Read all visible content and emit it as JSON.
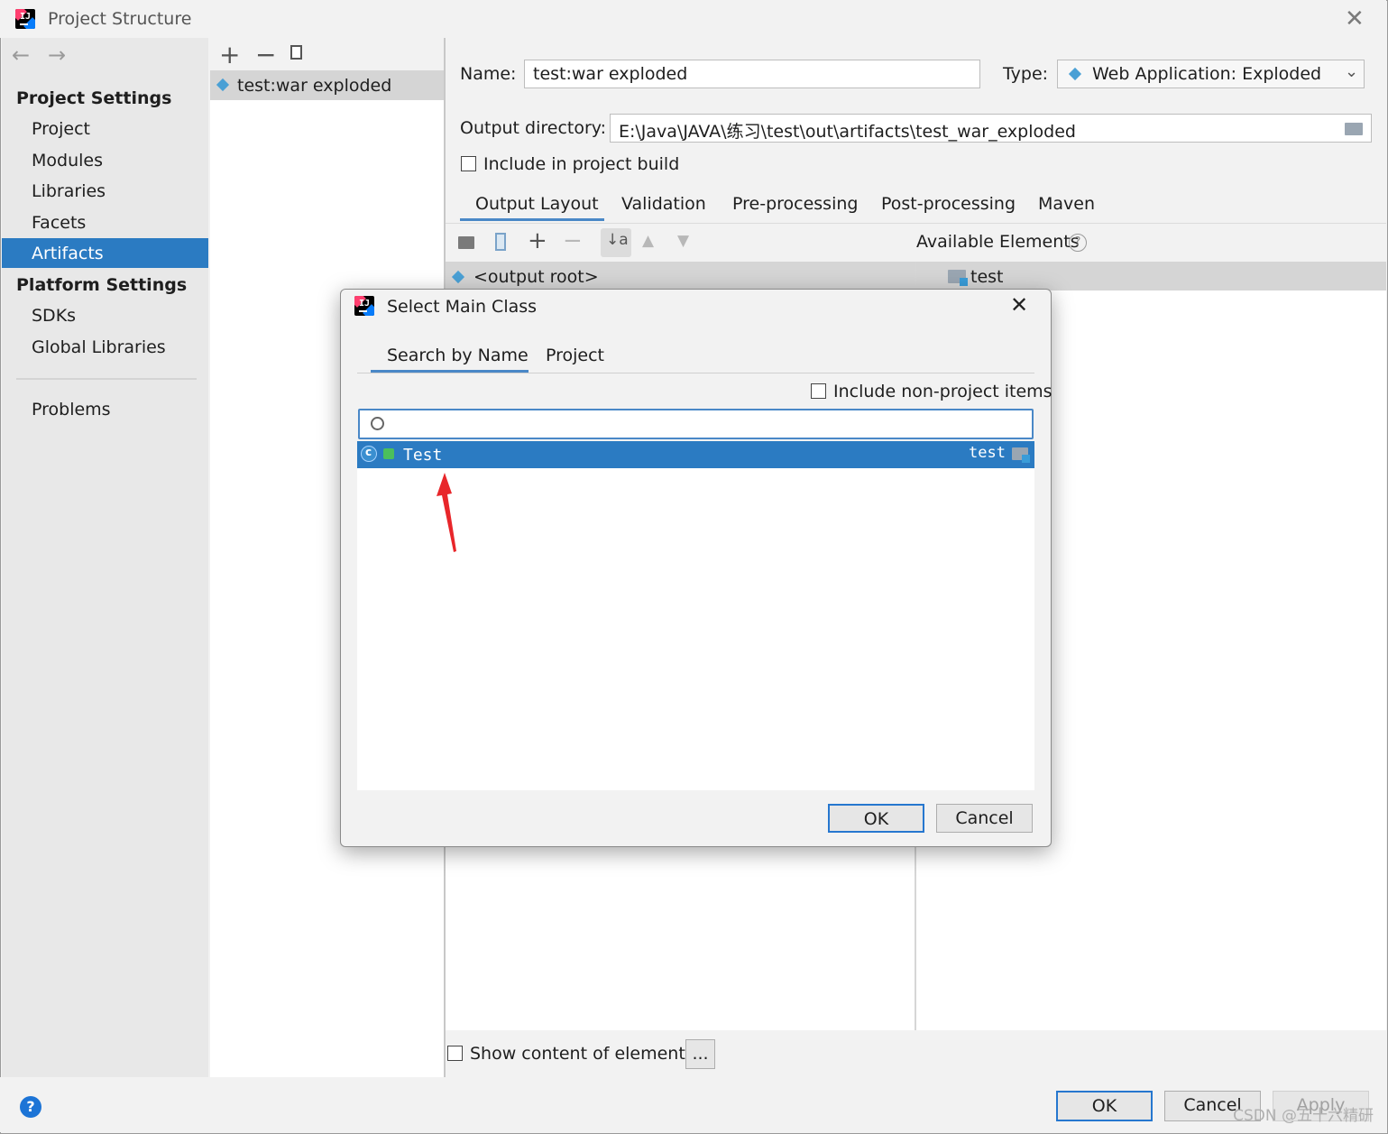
{
  "window": {
    "title": "Project Structure",
    "close_icon": "close-icon"
  },
  "sidebar": {
    "project_settings_heading": "Project Settings",
    "project_items": [
      "Project",
      "Modules",
      "Libraries",
      "Facets",
      "Artifacts"
    ],
    "selected": "Artifacts",
    "platform_settings_heading": "Platform Settings",
    "platform_items": [
      "SDKs",
      "Global Libraries"
    ],
    "problems": "Problems"
  },
  "artifact_list": {
    "items": [
      "test:war exploded"
    ]
  },
  "artifact": {
    "name_label": "Name:",
    "name_value": "test:war exploded",
    "type_label": "Type:",
    "type_value": "Web Application: Exploded",
    "output_dir_label": "Output directory:",
    "output_dir_value": "E:\\Java\\JAVA\\练习\\test\\out\\artifacts\\test_war_exploded",
    "include_build_label": "Include in project build",
    "include_build_checked": false
  },
  "tabs": [
    "Output Layout",
    "Validation",
    "Pre-processing",
    "Post-processing",
    "Maven"
  ],
  "active_tab": "Output Layout",
  "layout": {
    "available_elements_label": "Available Elements",
    "output_root": "<output root>",
    "available_items": [
      "test"
    ],
    "show_content_label": "Show content of elements",
    "ellipsis_button": "..."
  },
  "footer": {
    "ok": "OK",
    "cancel": "Cancel",
    "apply": "Apply",
    "help": "?"
  },
  "dialog": {
    "title": "Select Main Class",
    "tabs": [
      "Search by Name",
      "Project"
    ],
    "active_tab": "Search by Name",
    "include_non_project_label": "Include non-project items",
    "search_value": "",
    "results": [
      {
        "name": "Test",
        "module": "test"
      }
    ],
    "ok": "OK",
    "cancel": "Cancel"
  },
  "watermark": "CSDN @五十六精研",
  "colors": {
    "selection": "#2b7bc2",
    "accent": "#4a88c7",
    "annotation_arrow": "#e8262a"
  }
}
